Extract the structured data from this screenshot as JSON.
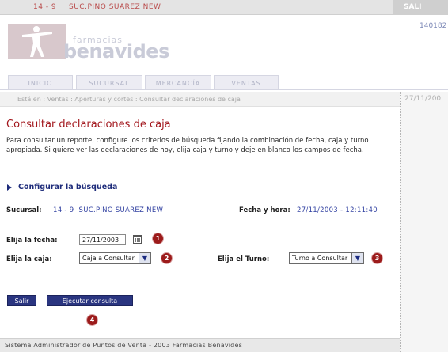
{
  "topbar": {
    "store_code": "14 - 9",
    "store_name": "SUC.PINO SUAREZ NEW",
    "exit_label": "SALI"
  },
  "header": {
    "ticket_number": "140182",
    "logo_subtitle": "farmacias",
    "logo_brand": "benavides"
  },
  "nav": {
    "tabs": [
      {
        "label": "INICIO"
      },
      {
        "label": "SUCURSAL"
      },
      {
        "label": "MERCANCÍA"
      },
      {
        "label": "VENTAS"
      }
    ]
  },
  "breadcrumb": {
    "text": "Está en : Ventas : Aperturas y cortes : Consultar declaraciones de caja",
    "date_partial": "27/11/200"
  },
  "main": {
    "title": "Consultar declaraciones de caja",
    "intro": "Para consultar un reporte, configure los criterios de búsqueda fijando la combinación de fecha, caja y turno apropiada. Si quiere ver las declaraciones de hoy, elija caja y turno y deje en blanco los campos de fecha.",
    "config_link": "Configurar la búsqueda",
    "sucursal_label": "Sucursal:",
    "sucursal_value": "14 - 9  SUC.PINO SUAREZ NEW",
    "datetime_label": "Fecha y hora:",
    "datetime_value": "27/11/2003 - 12:11:40",
    "date_label": "Elija la fecha:",
    "date_value": "27/11/2003",
    "caja_label": "Elija la caja:",
    "caja_selected": "Caja a Consultar",
    "turno_label": "Elija el Turno:",
    "turno_selected": "Turno a Consultar",
    "step_numbers": [
      "1",
      "2",
      "3",
      "4"
    ]
  },
  "buttons": {
    "exit": "Salir",
    "run_query": "Ejecutar consulta"
  },
  "footer": {
    "text": "Sistema Administrador de Puntos de Venta - 2003 Farmacias Benavides"
  },
  "colors": {
    "title_red": "#a2161c",
    "link_blue": "#1d2b7a",
    "value_blue": "#2f3fa0",
    "button_blue": "#2a3580",
    "badge_red": "#9c1b1b"
  }
}
